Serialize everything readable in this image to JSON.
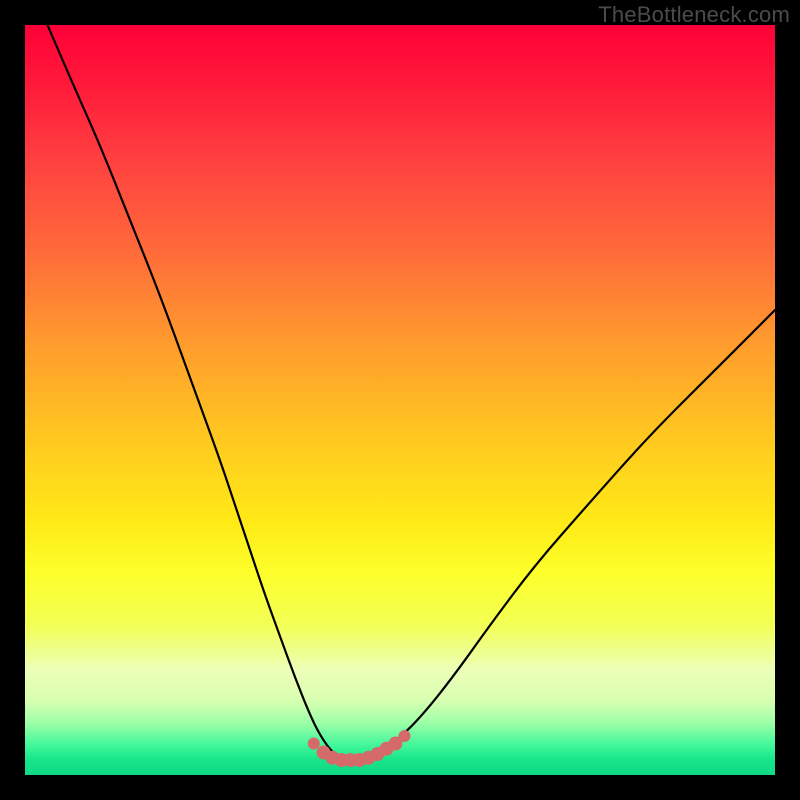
{
  "watermark": "TheBottleneck.com",
  "chart_data": {
    "type": "line",
    "title": "",
    "xlabel": "",
    "ylabel": "",
    "xlim": [
      0,
      100
    ],
    "ylim": [
      0,
      100
    ],
    "series": [
      {
        "name": "bottleneck-curve",
        "x": [
          3,
          6,
          10,
          14,
          18,
          22,
          26,
          28,
          30,
          32,
          34,
          36,
          38,
          39.5,
          41,
          42.5,
          44,
          46,
          48,
          50,
          53,
          57,
          62,
          68,
          75,
          83,
          91,
          98,
          100
        ],
        "y": [
          100,
          93,
          84,
          74,
          64,
          53,
          42,
          36,
          30,
          24,
          18.5,
          13,
          8,
          5,
          3,
          2,
          2,
          2.5,
          3.5,
          5,
          8,
          13,
          20,
          28,
          36,
          45,
          53,
          60,
          62
        ]
      }
    ],
    "markers": {
      "name": "highlight-dots",
      "color": "#d46a6a",
      "x": [
        38.5,
        39.8,
        41,
        42.2,
        43.4,
        44.6,
        45.8,
        47,
        48.2,
        49.4,
        50.6
      ],
      "y": [
        4.2,
        3.0,
        2.3,
        2.0,
        2.0,
        2.0,
        2.3,
        2.8,
        3.5,
        4.2,
        5.2
      ]
    }
  }
}
